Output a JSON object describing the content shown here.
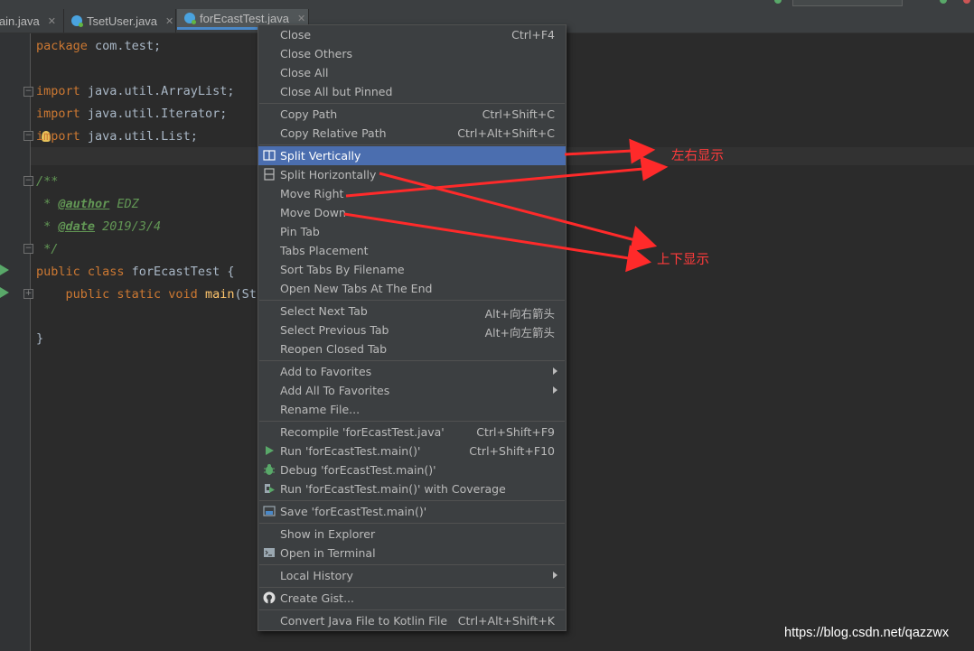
{
  "tabs": [
    {
      "label": "Main.java",
      "visible": "lain.java",
      "closable": true
    },
    {
      "label": "TsetUser.java",
      "closable": true
    },
    {
      "label": "forEcastTest.java",
      "closable": true,
      "active": true
    }
  ],
  "tab_close_glyph": "✕",
  "code": {
    "l1a": "package",
    "l1b": " com.test;",
    "l3a": "import",
    "l3b": " java.util.ArrayList;",
    "l4a": "import",
    "l4b": " java.util.Iterator;",
    "l5a": "import",
    "l5b": " java.util.List;",
    "l7": "/**",
    "l8a": " * ",
    "l8b": "@author",
    "l8c": " EDZ",
    "l9a": " * ",
    "l9b": "@date",
    "l9c": " 2019/3/4",
    "l10": " */",
    "l11a": "public class",
    "l11b": " forEcastTest {",
    "l12a": "    public static void",
    "l12b": " main",
    "l12c": "(Str",
    "l14": "}"
  },
  "menu": {
    "items": [
      {
        "label": "Close",
        "shortcut": "Ctrl+F4"
      },
      {
        "label": "Close Others",
        "shortcut": ""
      },
      {
        "label": "Close All",
        "shortcut": ""
      },
      {
        "label": "Close All but Pinned",
        "shortcut": ""
      },
      {
        "label": "Copy Path",
        "shortcut": "Ctrl+Shift+C"
      },
      {
        "label": "Copy Relative Path",
        "shortcut": "Ctrl+Alt+Shift+C"
      },
      {
        "label": "Split Vertically",
        "shortcut": "",
        "icon": "split-vertically-icon",
        "selected": true
      },
      {
        "label": "Split Horizontally",
        "shortcut": "",
        "icon": "split-horizontally-icon"
      },
      {
        "label": "Move Right",
        "shortcut": ""
      },
      {
        "label": "Move Down",
        "shortcut": ""
      },
      {
        "label": "Pin Tab",
        "shortcut": ""
      },
      {
        "label": "Tabs Placement",
        "shortcut": ""
      },
      {
        "label": "Sort Tabs By Filename",
        "shortcut": ""
      },
      {
        "label": "Open New Tabs At The End",
        "shortcut": ""
      },
      {
        "label": "Select Next Tab",
        "shortcut": "Alt+向右箭头"
      },
      {
        "label": "Select Previous Tab",
        "shortcut": "Alt+向左箭头"
      },
      {
        "label": "Reopen Closed Tab",
        "shortcut": ""
      },
      {
        "label": "Add to Favorites",
        "submenu": true
      },
      {
        "label": "Add All To Favorites",
        "submenu": true
      },
      {
        "label": "Rename File...",
        "shortcut": ""
      },
      {
        "label": "Recompile 'forEcastTest.java'",
        "shortcut": "Ctrl+Shift+F9"
      },
      {
        "label": "Run 'forEcastTest.main()'",
        "shortcut": "Ctrl+Shift+F10",
        "icon": "run-icon"
      },
      {
        "label": "Debug 'forEcastTest.main()'",
        "shortcut": "",
        "icon": "debug-icon"
      },
      {
        "label": "Run 'forEcastTest.main()' with Coverage",
        "shortcut": "",
        "icon": "coverage-icon"
      },
      {
        "label": "Save 'forEcastTest.main()'",
        "shortcut": "",
        "icon": "save-icon"
      },
      {
        "label": "Show in Explorer",
        "shortcut": ""
      },
      {
        "label": "Open in Terminal",
        "shortcut": "",
        "icon": "terminal-icon"
      },
      {
        "label": "Local History",
        "submenu": true
      },
      {
        "label": "Create Gist...",
        "shortcut": "",
        "icon": "github-icon"
      },
      {
        "label": "Convert Java File to Kotlin File",
        "shortcut": "Ctrl+Alt+Shift+K"
      }
    ]
  },
  "annotations": {
    "left_right": "左右显示",
    "top_bottom": "上下显示"
  },
  "watermark": "https://blog.csdn.net/qazzwx",
  "colors": {
    "menu_bg": "#3c3f41",
    "selection": "#4b6eaf",
    "annotation": "#ff3b3b",
    "editor_bg": "#2b2b2b"
  }
}
